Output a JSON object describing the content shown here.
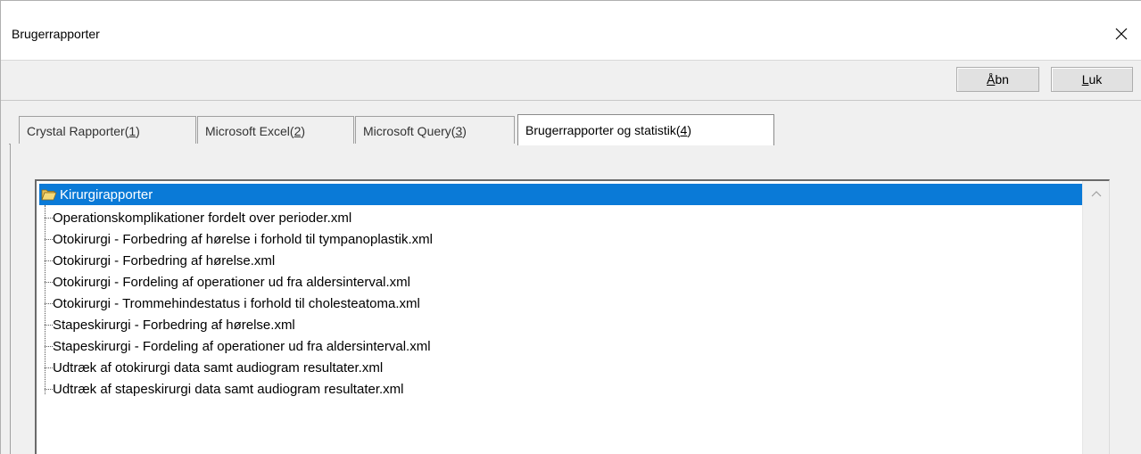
{
  "window": {
    "title": "Brugerrapporter"
  },
  "toolbar": {
    "open": {
      "mnemonic": "Å",
      "rest": "bn"
    },
    "close": {
      "mnemonic": "L",
      "rest": "uk"
    }
  },
  "tabs": [
    {
      "label": "Crystal Rapporter(",
      "key": "1",
      "suffix": ")"
    },
    {
      "label": "Microsoft Excel(",
      "key": "2",
      "suffix": ")"
    },
    {
      "label": "Microsoft Query(",
      "key": "3",
      "suffix": ")"
    },
    {
      "label": "Brugerrapporter og statistik(",
      "key": "4",
      "suffix": ")"
    }
  ],
  "active_tab_index": 3,
  "tree": {
    "folder": {
      "label": "Kirurgirapporter",
      "icon": "open-folder-icon"
    },
    "items": [
      "Operationskomplikationer fordelt over perioder.xml",
      "Otokirurgi - Forbedring af hørelse i forhold til tympanoplastik.xml",
      "Otokirurgi - Forbedring af hørelse.xml",
      "Otokirurgi - Fordeling af operationer ud fra aldersinterval.xml",
      "Otokirurgi - Trommehindestatus i forhold til cholesteatoma.xml",
      "Stapeskirurgi - Forbedring af hørelse.xml",
      "Stapeskirurgi - Fordeling af operationer ud fra aldersinterval.xml",
      "Udtræk af otokirurgi data samt audiogram resultater.xml",
      "Udtræk af stapeskirurgi data samt audiogram resultater.xml"
    ]
  },
  "colors": {
    "selection": "#0a7ad7",
    "window_bg": "#f0f0f0"
  }
}
